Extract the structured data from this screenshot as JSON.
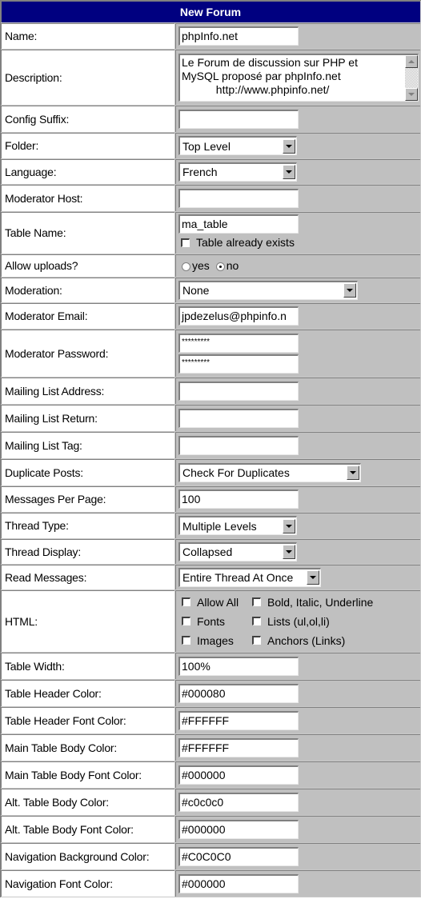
{
  "header": {
    "title": "New Forum"
  },
  "colors": {
    "header_bg": "#000080",
    "header_fg": "#FFFFFF",
    "label_bg": "#FFFFFF",
    "value_bg": "#C0C0C0"
  },
  "fields": {
    "name": {
      "label": "Name:",
      "value": "phpInfo.net"
    },
    "description": {
      "label": "Description:",
      "value": "Le Forum de discussion sur PHP et\nMySQL proposé par phpInfo.net\n           http://www.phpinfo.net/"
    },
    "config_suffix": {
      "label": "Config Suffix:",
      "value": ""
    },
    "folder": {
      "label": "Folder:",
      "selected": "Top Level"
    },
    "language": {
      "label": "Language:",
      "selected": "French"
    },
    "moderator_host": {
      "label": "Moderator Host:",
      "value": ""
    },
    "table_name": {
      "label": "Table Name:",
      "value": "ma_table",
      "exists_label": "Table already exists",
      "exists_checked": false
    },
    "allow_uploads": {
      "label": "Allow uploads?",
      "options": [
        "yes",
        "no"
      ],
      "selected": "no"
    },
    "moderation": {
      "label": "Moderation:",
      "selected": "None"
    },
    "moderator_email": {
      "label": "Moderator Email:",
      "value": "jpdezelus@phpinfo.n"
    },
    "moderator_password": {
      "label": "Moderator Password:",
      "value": "*********",
      "confirm": "*********"
    },
    "mailing_list_address": {
      "label": "Mailing List Address:",
      "value": ""
    },
    "mailing_list_return": {
      "label": "Mailing List Return:",
      "value": ""
    },
    "mailing_list_tag": {
      "label": "Mailing List Tag:",
      "value": ""
    },
    "duplicate_posts": {
      "label": "Duplicate Posts:",
      "selected": "Check For Duplicates"
    },
    "messages_per_page": {
      "label": "Messages Per Page:",
      "value": "100"
    },
    "thread_type": {
      "label": "Thread Type:",
      "selected": "Multiple Levels"
    },
    "thread_display": {
      "label": "Thread Display:",
      "selected": "Collapsed"
    },
    "read_messages": {
      "label": "Read Messages:",
      "selected": "Entire Thread At Once"
    },
    "html": {
      "label": "HTML:",
      "options": [
        {
          "label": "Allow All",
          "checked": false
        },
        {
          "label": "Bold, Italic, Underline",
          "checked": false
        },
        {
          "label": "Fonts",
          "checked": false
        },
        {
          "label": "Lists (ul,ol,li)",
          "checked": false
        },
        {
          "label": "Images",
          "checked": false
        },
        {
          "label": "Anchors (Links)",
          "checked": false
        }
      ]
    },
    "table_width": {
      "label": "Table Width:",
      "value": "100%"
    },
    "table_header_color": {
      "label": "Table Header Color:",
      "value": "#000080"
    },
    "table_header_font_color": {
      "label": "Table Header Font Color:",
      "value": "#FFFFFF"
    },
    "main_table_body_color": {
      "label": "Main Table Body Color:",
      "value": "#FFFFFF"
    },
    "main_table_body_font_color": {
      "label": "Main Table Body Font Color:",
      "value": "#000000"
    },
    "alt_table_body_color": {
      "label": "Alt. Table Body Color:",
      "value": "#c0c0c0"
    },
    "alt_table_body_font_color": {
      "label": "Alt. Table Body Font Color:",
      "value": "#000000"
    },
    "navigation_background_color": {
      "label": "Navigation Background Color:",
      "value": "#C0C0C0"
    },
    "navigation_font_color": {
      "label": "Navigation Font Color:",
      "value": "#000000"
    }
  }
}
